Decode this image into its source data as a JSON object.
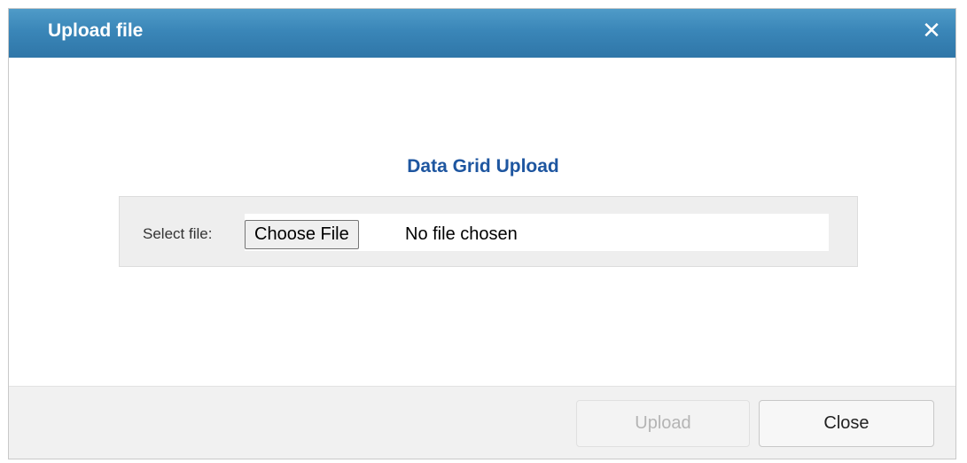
{
  "dialog": {
    "title": "Upload file",
    "close_icon": "close-icon",
    "heading": "Data Grid Upload",
    "file_picker": {
      "label": "Select file:",
      "button_label": "Choose File",
      "status": "No file chosen"
    },
    "footer": {
      "upload_label": "Upload",
      "upload_disabled": true,
      "close_label": "Close"
    }
  },
  "colors": {
    "titlebar": "#3a86b8",
    "heading": "#1e56a0",
    "panel": "#eeeeee",
    "footer": "#f1f1f1"
  }
}
